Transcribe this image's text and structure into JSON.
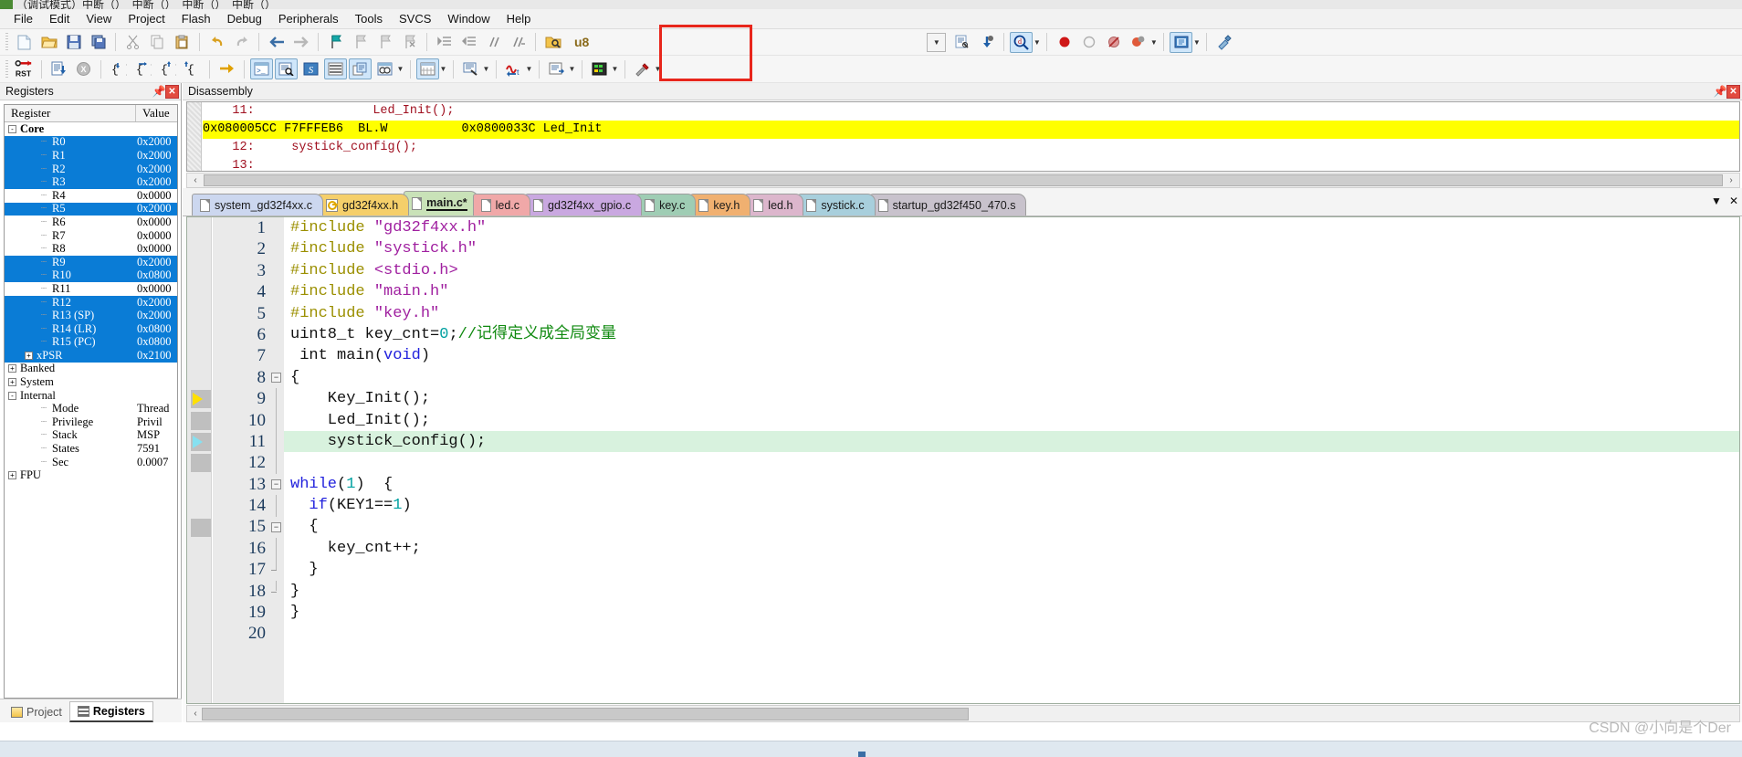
{
  "window": {
    "title": "（调试模式）中断（）_中断（）_中断（）_中断（）"
  },
  "menubar": {
    "items": [
      {
        "label": "File",
        "name": "menu-file"
      },
      {
        "label": "Edit",
        "name": "menu-edit"
      },
      {
        "label": "View",
        "name": "menu-view"
      },
      {
        "label": "Project",
        "name": "menu-project"
      },
      {
        "label": "Flash",
        "name": "menu-flash"
      },
      {
        "label": "Debug",
        "name": "menu-debug"
      },
      {
        "label": "Peripherals",
        "name": "menu-peripherals"
      },
      {
        "label": "Tools",
        "name": "menu-tools"
      },
      {
        "label": "SVCS",
        "name": "menu-svcs"
      },
      {
        "label": "Window",
        "name": "menu-window"
      },
      {
        "label": "Help",
        "name": "menu-help"
      }
    ]
  },
  "toolbar1": {
    "icons": [
      "new-file-icon",
      "open-file-icon",
      "save-icon",
      "save-all-icon",
      "cut-icon",
      "copy-icon",
      "paste-icon",
      "undo-icon",
      "redo-icon",
      "navigate-back-icon",
      "navigate-forward-icon",
      "bookmark-toggle-icon",
      "bookmark-prev-icon",
      "bookmark-next-icon",
      "bookmark-clear-icon",
      "indent-icon",
      "outdent-icon",
      "comment-icon",
      "uncomment-icon",
      "find-in-files-icon"
    ],
    "combo_value": "u8",
    "combo_placeholder": "",
    "right_icons": [
      "dropdown-blank-icon",
      "insert-watch-icon",
      "debug-bookmark-icon",
      "find-target-icon",
      "dropdown-arrow-icon",
      "breakpoint-icon",
      "disable-breakpoint-icon",
      "kill-breakpoints-icon",
      "disable-all-breakpoints-icon",
      "dropdown-arrow-icon",
      "show-next-statement-icon",
      "dropdown-arrow-icon",
      "configure-icon"
    ]
  },
  "toolbar2": {
    "icons": [
      "reset-icon",
      "run-icon",
      "stop-icon",
      "step-into-icon",
      "step-over-icon",
      "step-out-icon",
      "run-to-cursor-icon",
      "show-next-statement-icon",
      "command-window-icon",
      "disassembly-window-icon",
      "symbols-window-icon",
      "registers-window-icon",
      "call-stack-window-icon",
      "watch-window-icon",
      "memory-window-icon",
      "serial-window-icon",
      "analysis-window-icon",
      "trace-window-icon",
      "system-viewer-icon",
      "toolbox-icon"
    ]
  },
  "annotation": {
    "shape": "rectangle",
    "color": "#e8261c"
  },
  "registers_panel": {
    "title": "Registers",
    "pin_icon": "pin-icon",
    "close_icon": "close-icon",
    "columns": [
      "Register",
      "Value"
    ],
    "rows": [
      {
        "label": "Core",
        "value": "",
        "indent": 0,
        "toggle": "-",
        "bold": true,
        "selected": false
      },
      {
        "label": "R0",
        "value": "0x2000",
        "indent": 2,
        "toggle": "",
        "bold": false,
        "selected": true
      },
      {
        "label": "R1",
        "value": "0x2000",
        "indent": 2,
        "toggle": "",
        "bold": false,
        "selected": true
      },
      {
        "label": "R2",
        "value": "0x2000",
        "indent": 2,
        "toggle": "",
        "bold": false,
        "selected": true
      },
      {
        "label": "R3",
        "value": "0x2000",
        "indent": 2,
        "toggle": "",
        "bold": false,
        "selected": true
      },
      {
        "label": "R4",
        "value": "0x0000",
        "indent": 2,
        "toggle": "",
        "bold": false,
        "selected": false
      },
      {
        "label": "R5",
        "value": "0x2000",
        "indent": 2,
        "toggle": "",
        "bold": false,
        "selected": true
      },
      {
        "label": "R6",
        "value": "0x0000",
        "indent": 2,
        "toggle": "",
        "bold": false,
        "selected": false
      },
      {
        "label": "R7",
        "value": "0x0000",
        "indent": 2,
        "toggle": "",
        "bold": false,
        "selected": false
      },
      {
        "label": "R8",
        "value": "0x0000",
        "indent": 2,
        "toggle": "",
        "bold": false,
        "selected": false
      },
      {
        "label": "R9",
        "value": "0x2000",
        "indent": 2,
        "toggle": "",
        "bold": false,
        "selected": true
      },
      {
        "label": "R10",
        "value": "0x0800",
        "indent": 2,
        "toggle": "",
        "bold": false,
        "selected": true
      },
      {
        "label": "R11",
        "value": "0x0000",
        "indent": 2,
        "toggle": "",
        "bold": false,
        "selected": false
      },
      {
        "label": "R12",
        "value": "0x2000",
        "indent": 2,
        "toggle": "",
        "bold": false,
        "selected": true
      },
      {
        "label": "R13 (SP)",
        "value": "0x2000",
        "indent": 2,
        "toggle": "",
        "bold": false,
        "selected": true
      },
      {
        "label": "R14 (LR)",
        "value": "0x0800",
        "indent": 2,
        "toggle": "",
        "bold": false,
        "selected": true
      },
      {
        "label": "R15 (PC)",
        "value": "0x0800",
        "indent": 2,
        "toggle": "",
        "bold": false,
        "selected": true
      },
      {
        "label": "xPSR",
        "value": "0x2100",
        "indent": 1,
        "toggle": "+",
        "bold": false,
        "selected": true
      },
      {
        "label": "Banked",
        "value": "",
        "indent": 0,
        "toggle": "+",
        "bold": false,
        "selected": false
      },
      {
        "label": "System",
        "value": "",
        "indent": 0,
        "toggle": "+",
        "bold": false,
        "selected": false
      },
      {
        "label": "Internal",
        "value": "",
        "indent": 0,
        "toggle": "-",
        "bold": false,
        "selected": false
      },
      {
        "label": "Mode",
        "value": "Thread",
        "indent": 2,
        "toggle": "",
        "bold": false,
        "selected": false
      },
      {
        "label": "Privilege",
        "value": "Privil",
        "indent": 2,
        "toggle": "",
        "bold": false,
        "selected": false
      },
      {
        "label": "Stack",
        "value": "MSP",
        "indent": 2,
        "toggle": "",
        "bold": false,
        "selected": false
      },
      {
        "label": "States",
        "value": "7591",
        "indent": 2,
        "toggle": "",
        "bold": false,
        "selected": false
      },
      {
        "label": "Sec",
        "value": "0.0007",
        "indent": 2,
        "toggle": "",
        "bold": false,
        "selected": false
      },
      {
        "label": "FPU",
        "value": "",
        "indent": 0,
        "toggle": "+",
        "bold": false,
        "selected": false
      }
    ],
    "bottom_tabs": [
      {
        "label": "Project",
        "icon": "project-icon",
        "active": false
      },
      {
        "label": "Registers",
        "icon": "registers-icon",
        "active": true
      }
    ]
  },
  "disassembly": {
    "title": "Disassembly",
    "pin_icon": "pin-icon",
    "close_icon": "close-icon",
    "lines": [
      {
        "text": "    11:                Led_Init();",
        "type": "source",
        "highlight": false
      },
      {
        "text": "0x080005CC F7FFFEB6  BL.W          0x0800033C Led_Init",
        "type": "asm",
        "highlight": true
      },
      {
        "text": "    12:     systick_config();",
        "type": "source",
        "highlight": false
      },
      {
        "text": "    13:",
        "type": "source",
        "highlight": false
      }
    ],
    "scroll_left_arrow": "‹",
    "scroll_right_arrow": "›"
  },
  "editor": {
    "tabs": [
      {
        "label": "system_gd32f4xx.c",
        "color": "#ccd7ef",
        "icon": "file-icon",
        "active": false
      },
      {
        "label": "gd32f4xx.h",
        "color": "#f5cf6a",
        "icon": "key-file-icon",
        "active": false
      },
      {
        "label": "main.c*",
        "color": "#c9e2b8",
        "icon": "file-icon",
        "active": true
      },
      {
        "label": "led.c",
        "color": "#f0a8a8",
        "icon": "file-icon",
        "active": false
      },
      {
        "label": "gd32f4xx_gpio.c",
        "color": "#c9a8e0",
        "icon": "file-icon",
        "active": false
      },
      {
        "label": "key.c",
        "color": "#9fcdb4",
        "icon": "file-icon",
        "active": false
      },
      {
        "label": "key.h",
        "color": "#f0b070",
        "icon": "file-icon",
        "active": false
      },
      {
        "label": "led.h",
        "color": "#dcb6cc",
        "icon": "file-icon",
        "active": false
      },
      {
        "label": "systick.c",
        "color": "#a8cfdc",
        "icon": "file-icon",
        "active": false
      },
      {
        "label": "startup_gd32f450_470.s",
        "color": "#c8c2cc",
        "icon": "file-icon",
        "active": false
      }
    ],
    "tabbar_buttons": [
      {
        "label": "▼",
        "name": "tab-list-dropdown"
      },
      {
        "label": "✕",
        "name": "close-tab-button"
      }
    ],
    "code": [
      {
        "n": 1,
        "marker": "none",
        "fold": "",
        "exec": false,
        "tokens": [
          [
            "k-pre",
            "#include "
          ],
          [
            "k-str",
            "\"gd32f4xx.h\""
          ]
        ]
      },
      {
        "n": 2,
        "marker": "none",
        "fold": "",
        "exec": false,
        "tokens": [
          [
            "k-pre",
            "#include "
          ],
          [
            "k-str",
            "\"systick.h\""
          ]
        ]
      },
      {
        "n": 3,
        "marker": "none",
        "fold": "",
        "exec": false,
        "tokens": [
          [
            "k-pre",
            "#include "
          ],
          [
            "k-str",
            "<stdio.h>"
          ]
        ]
      },
      {
        "n": 4,
        "marker": "none",
        "fold": "",
        "exec": false,
        "tokens": [
          [
            "k-pre",
            "#include "
          ],
          [
            "k-str",
            "\"main.h\""
          ]
        ]
      },
      {
        "n": 5,
        "marker": "none",
        "fold": "",
        "exec": false,
        "tokens": [
          [
            "k-pre",
            "#include "
          ],
          [
            "k-str",
            "\"key.h\""
          ]
        ]
      },
      {
        "n": 6,
        "marker": "none",
        "fold": "",
        "exec": false,
        "tokens": [
          [
            "k-txt",
            "uint8_t key_cnt="
          ],
          [
            "k-num",
            "0"
          ],
          [
            "k-txt",
            ";"
          ],
          [
            "k-cmt",
            "//记得定义成全局变量"
          ]
        ]
      },
      {
        "n": 7,
        "marker": "none",
        "fold": "",
        "exec": false,
        "tokens": [
          [
            "k-txt",
            " int main("
          ],
          [
            "k-kw",
            "void"
          ],
          [
            "k-txt",
            ")"
          ]
        ]
      },
      {
        "n": 8,
        "marker": "none",
        "fold": "-",
        "exec": false,
        "tokens": [
          [
            "k-txt",
            "{"
          ]
        ]
      },
      {
        "n": 9,
        "marker": "yellow",
        "fold": "|",
        "exec": false,
        "tokens": [
          [
            "k-txt",
            "    Key_Init();"
          ]
        ]
      },
      {
        "n": 10,
        "marker": "box",
        "fold": "|",
        "exec": false,
        "tokens": [
          [
            "k-txt",
            "    Led_Init();"
          ]
        ]
      },
      {
        "n": 11,
        "marker": "cyan",
        "fold": "|",
        "exec": true,
        "tokens": [
          [
            "k-txt",
            "    systick_config();"
          ]
        ]
      },
      {
        "n": 12,
        "marker": "box",
        "fold": "|",
        "exec": false,
        "tokens": [
          [
            "k-txt",
            ""
          ]
        ]
      },
      {
        "n": 13,
        "marker": "none",
        "fold": "-",
        "exec": false,
        "tokens": [
          [
            "k-kw",
            "while"
          ],
          [
            "k-txt",
            "("
          ],
          [
            "k-num",
            "1"
          ],
          [
            "k-txt",
            ")  {"
          ]
        ]
      },
      {
        "n": 14,
        "marker": "none",
        "fold": "|",
        "exec": false,
        "tokens": [
          [
            "k-txt",
            "  "
          ],
          [
            "k-kw",
            "if"
          ],
          [
            "k-txt",
            "(KEY1=="
          ],
          [
            "k-num",
            "1"
          ],
          [
            "k-txt",
            ")"
          ]
        ]
      },
      {
        "n": 15,
        "marker": "box",
        "fold": "-",
        "exec": false,
        "tokens": [
          [
            "k-txt",
            "  {"
          ]
        ]
      },
      {
        "n": 16,
        "marker": "none",
        "fold": "|",
        "exec": false,
        "tokens": [
          [
            "k-txt",
            "    key_cnt++;"
          ]
        ]
      },
      {
        "n": 17,
        "marker": "none",
        "fold": "t",
        "exec": false,
        "tokens": [
          [
            "k-txt",
            "  }"
          ]
        ]
      },
      {
        "n": 18,
        "marker": "none",
        "fold": "t",
        "exec": false,
        "tokens": [
          [
            "k-txt",
            "}"
          ]
        ]
      },
      {
        "n": 19,
        "marker": "none",
        "fold": "",
        "exec": false,
        "tokens": [
          [
            "k-txt",
            "}"
          ]
        ]
      },
      {
        "n": 20,
        "marker": "none",
        "fold": "",
        "exec": false,
        "tokens": [
          [
            "k-txt",
            ""
          ]
        ]
      }
    ],
    "code_indent_prefix": "    "
  },
  "watermark": {
    "text": "CSDN @小向是个Der"
  }
}
